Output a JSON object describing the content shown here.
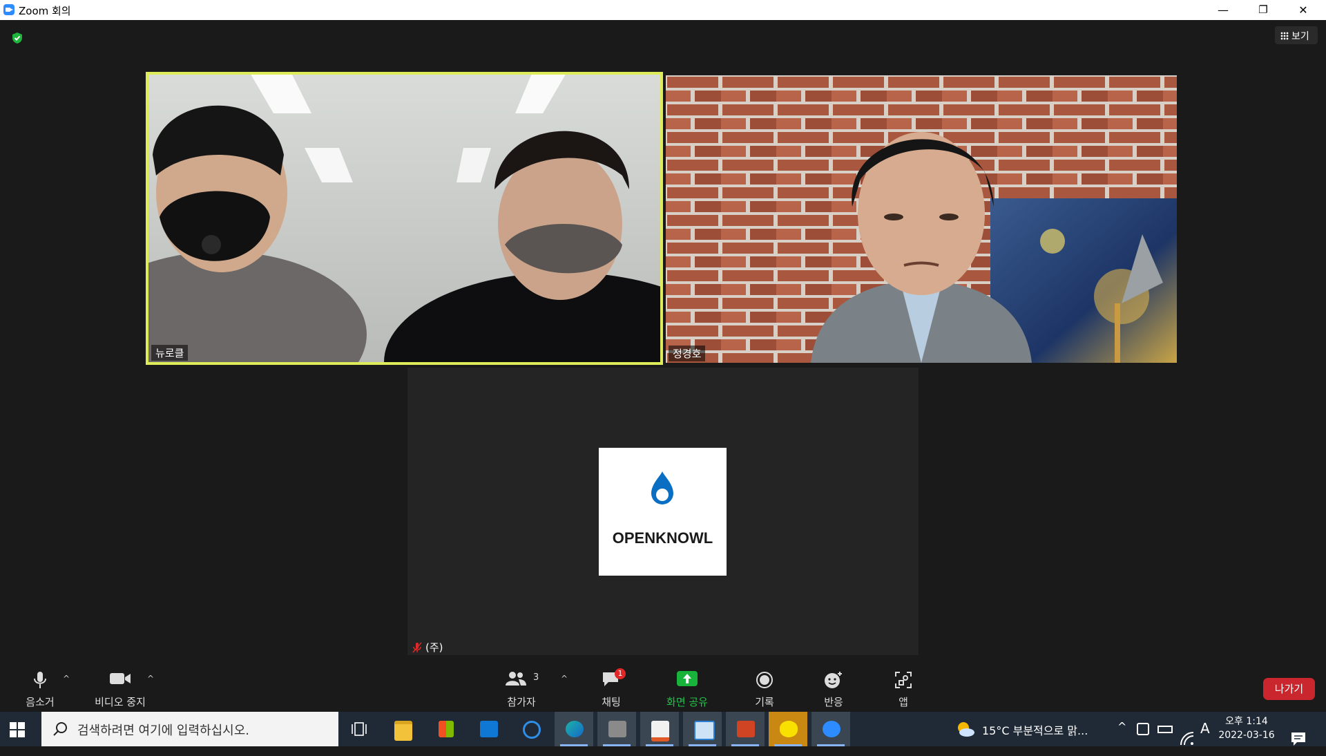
{
  "window": {
    "title": "Zoom 회의",
    "controls": {
      "minimize": "—",
      "restore": "❐",
      "close": "✕"
    }
  },
  "top_right": {
    "view_label": "보기"
  },
  "participants": [
    {
      "name": "뉴로클",
      "active_speaker": true,
      "video": "on"
    },
    {
      "name": "정경호",
      "active_speaker": false,
      "video": "on"
    },
    {
      "name": "(주)오픈놀",
      "active_speaker": false,
      "video": "off",
      "muted": true,
      "logo_text": "OPENKNOWL"
    }
  ],
  "toolbar": {
    "mute_label": "음소거",
    "video_label": "비디오 중지",
    "participants_label": "참가자",
    "participants_count": "3",
    "chat_label": "채팅",
    "chat_badge": "1",
    "share_label": "화면 공유",
    "record_label": "기록",
    "reactions_label": "반응",
    "apps_label": "앱",
    "leave_label": "나가기",
    "caret": "^"
  },
  "taskbar": {
    "search_placeholder": "검색하려면 여기에 입력하십시오.",
    "weather": "15°C  부분적으로 맑...",
    "ime": "A",
    "time": "오후 1:14",
    "date": "2022-03-16",
    "tray_chevron": "^"
  },
  "colors": {
    "active_speaker_border": "#dfec5a",
    "share_green": "#17b33a",
    "leave_red": "#c9262d",
    "zoom_blue": "#2d8cff"
  }
}
